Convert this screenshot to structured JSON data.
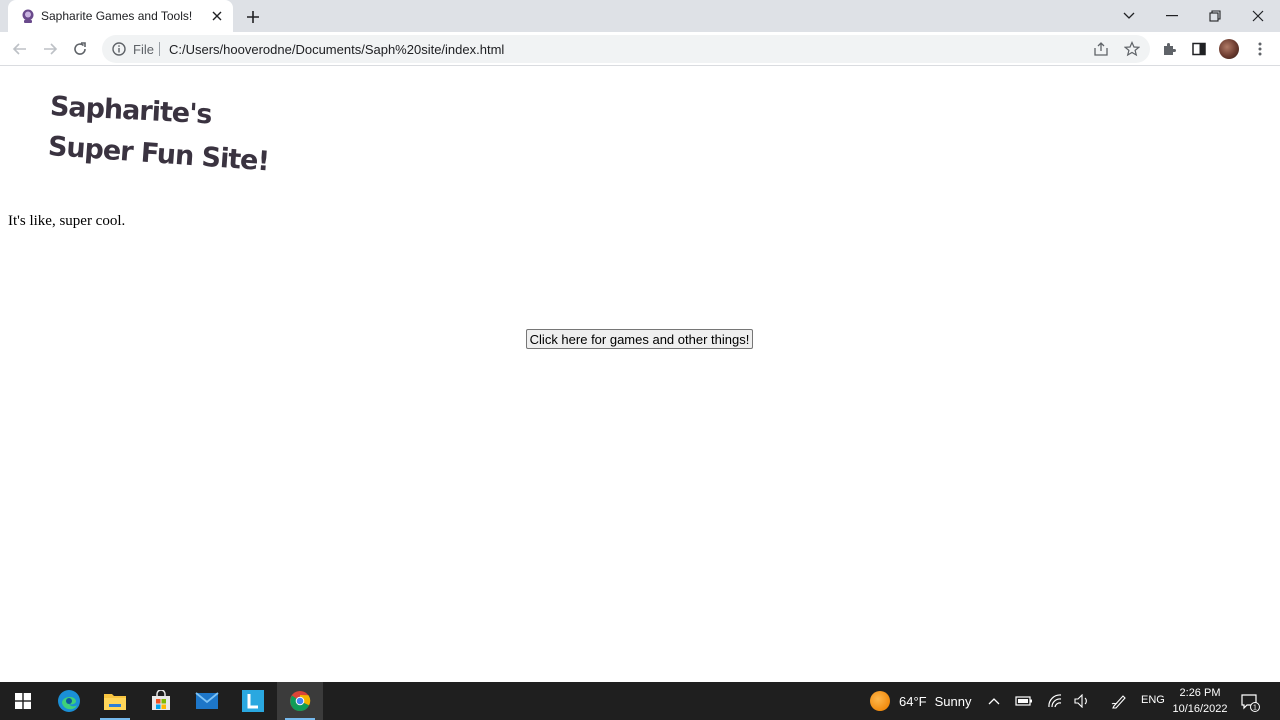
{
  "browser": {
    "tab": {
      "title": "Sapharite Games and Tools!",
      "favicon": "purple-icon"
    },
    "address_bar": {
      "scheme_label": "File",
      "url": "C:/Users/hooverodne/Documents/Saph%20site/index.html"
    }
  },
  "page": {
    "logo": {
      "line1": "Sapharite's",
      "line2": "Super Fun Site!"
    },
    "tagline": "It's like, super cool.",
    "button_label": "Click here for games and other things!"
  },
  "taskbar": {
    "weather": {
      "temperature": "64°F",
      "condition": "Sunny"
    },
    "language": "ENG",
    "time": "2:26 PM",
    "date": "10/16/2022",
    "notification_count": "1"
  },
  "colors": {
    "tabbar_bg": "#dee1e6",
    "taskbar_bg": "#1f1f1f",
    "logo_text": "#3a3340"
  }
}
